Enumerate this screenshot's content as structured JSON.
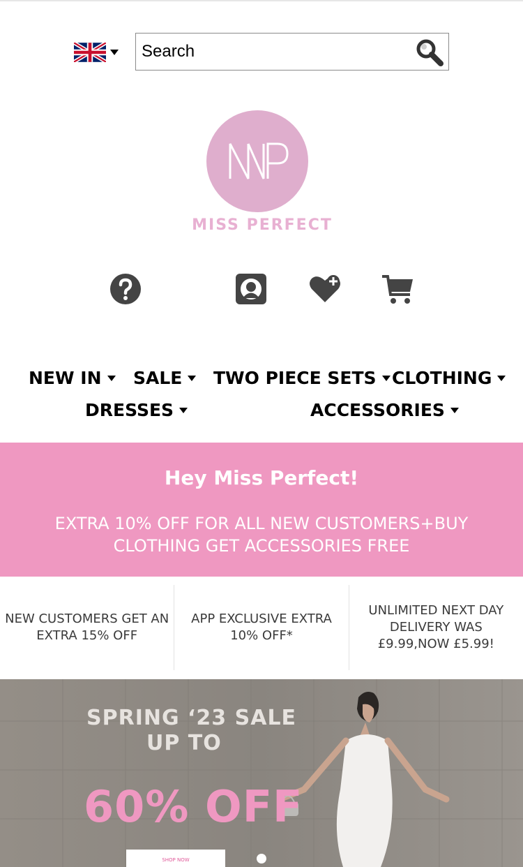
{
  "header": {
    "language": "English (UK)",
    "search_placeholder": "Search"
  },
  "brand": {
    "monogram": "MP",
    "name": "MISS PERFECT"
  },
  "icons": [
    "help-icon",
    "account-icon",
    "wishlist-icon",
    "cart-icon"
  ],
  "nav": {
    "items": [
      {
        "label": "NEW IN"
      },
      {
        "label": "SALE"
      },
      {
        "label": "TWO PIECE SETS"
      },
      {
        "label": "CLOTHING"
      },
      {
        "label": "DRESSES"
      },
      {
        "label": "ACCESSORIES"
      }
    ]
  },
  "promo": {
    "title": "Hey Miss Perfect!",
    "subtitle": "EXTRA 10% OFF FOR ALL NEW CUSTOMERS+BUY CLOTHING GET ACCESSORIES FREE"
  },
  "usps": [
    {
      "text": "NEW CUSTOMERS GET AN EXTRA 15% OFF"
    },
    {
      "text": "APP EXCLUSIVE EXTRA 10% OFF*"
    },
    {
      "text": "UNLIMITED NEXT DAY DELIVERY WAS £9.99,NOW £5.99!"
    }
  ],
  "hero": {
    "line1": "SPRING ‘23 SALE",
    "line2": "UP TO",
    "discount": "60% OFF",
    "cta": "SHOP NOW"
  },
  "colors": {
    "brand_pink": "#dfaecd",
    "promo_pink": "#ef98c1",
    "icon_grey": "#444444"
  }
}
